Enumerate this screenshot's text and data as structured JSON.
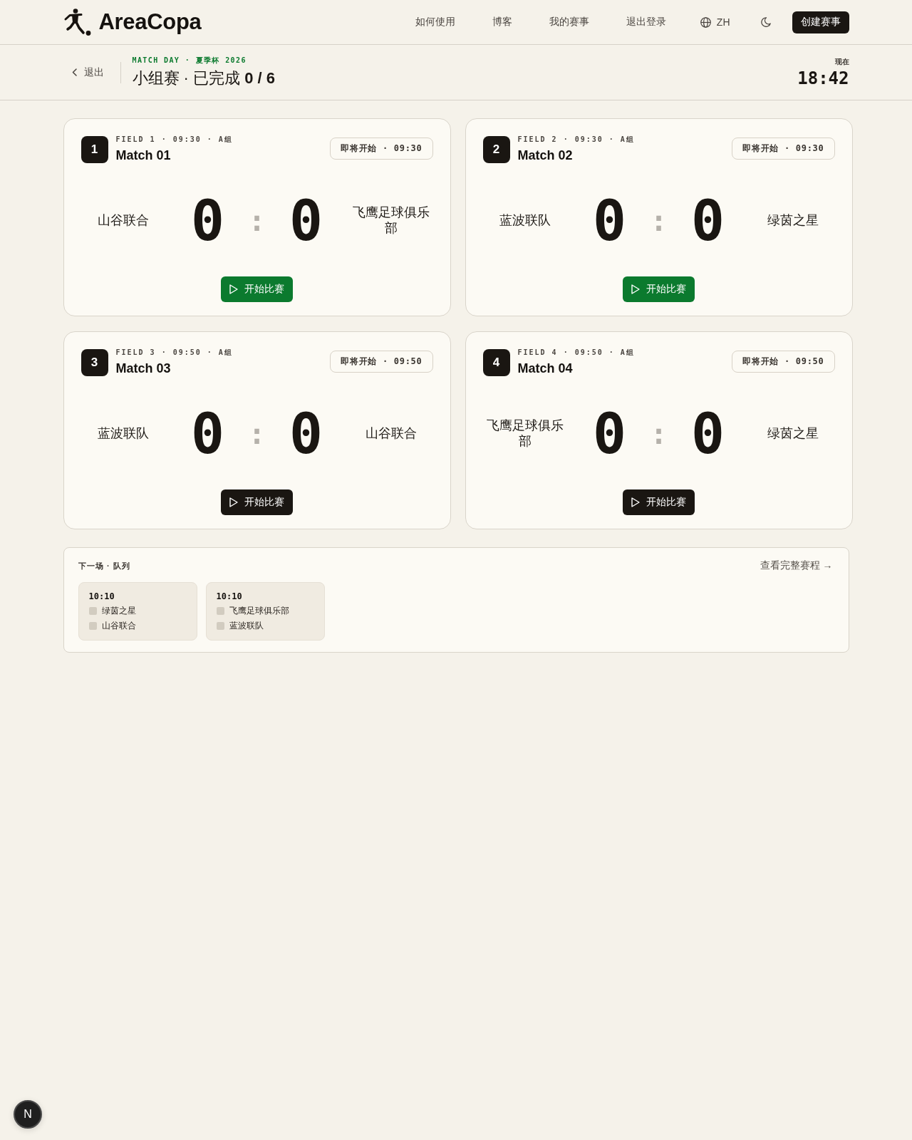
{
  "header": {
    "brand": "AreaCopa",
    "nav": [
      "如何使用",
      "博客",
      "我的赛事",
      "退出登录"
    ],
    "language": "ZH",
    "create_button": "创建赛事"
  },
  "topbar": {
    "back": "退出",
    "eyebrow": "MATCH DAY · 夏季杯 2026",
    "title": "小组赛 · 已完成 **0 / 6**",
    "clock_label": "现在",
    "clock": "18:42"
  },
  "matches": [
    {
      "number": "1",
      "meta": "FIELD 1 · 09:30 · A组",
      "title": "Match 01",
      "status": "即将开始 · 09:30",
      "home": "山谷联合",
      "home_score": "0",
      "separator": ":",
      "away_score": "0",
      "away": "飞鹰足球俱乐部",
      "start_button": {
        "label": "开始比赛",
        "primary": true
      }
    },
    {
      "number": "2",
      "meta": "FIELD 2 · 09:30 · A组",
      "title": "Match 02",
      "status": "即将开始 · 09:30",
      "home": "蓝波联队",
      "home_score": "0",
      "separator": ":",
      "away_score": "0",
      "away": "绿茵之星",
      "start_button": {
        "label": "开始比赛",
        "primary": true
      }
    },
    {
      "number": "3",
      "meta": "FIELD 3 · 09:50 · A组",
      "title": "Match 03",
      "status": "即将开始 · 09:50",
      "home": "蓝波联队",
      "home_score": "0",
      "separator": ":",
      "away_score": "0",
      "away": "山谷联合",
      "start_button": {
        "label": "开始比赛",
        "primary": false
      }
    },
    {
      "number": "4",
      "meta": "FIELD 4 · 09:50 · A组",
      "title": "Match 04",
      "status": "即将开始 · 09:50",
      "home": "飞鹰足球俱乐部",
      "home_score": "0",
      "separator": ":",
      "away_score": "0",
      "away": "绿茵之星",
      "start_button": {
        "label": "开始比赛",
        "primary": false
      }
    }
  ],
  "queue": {
    "title": "下一场 · 队列",
    "link": "查看完整赛程 →",
    "items": [
      {
        "time": "10:10",
        "teams": [
          "绿茵之星",
          "山谷联合"
        ]
      },
      {
        "time": "10:10",
        "teams": [
          "飞鹰足球俱乐部",
          "蓝波联队"
        ]
      }
    ]
  },
  "dev_indicator": "N"
}
